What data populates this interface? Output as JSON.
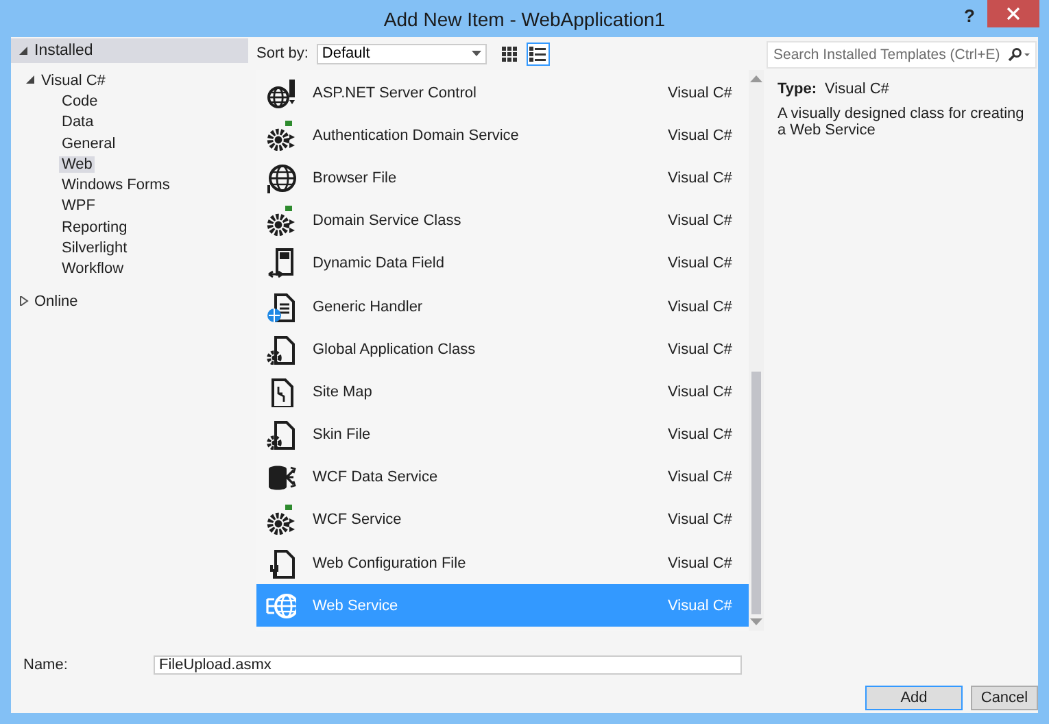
{
  "window": {
    "title": "Add New Item - WebApplication1",
    "help_button": "?"
  },
  "tree": [
    {
      "label": "Installed",
      "expanded": true,
      "selected": false,
      "children": [
        {
          "label": "Visual C#",
          "expanded": true,
          "selected": false,
          "children": [
            {
              "label": "Code",
              "selected": false
            },
            {
              "label": "Data",
              "selected": false
            },
            {
              "label": "General",
              "selected": false
            },
            {
              "label": "Web",
              "selected": true
            },
            {
              "label": "Windows Forms",
              "selected": false
            },
            {
              "label": "WPF",
              "selected": false
            },
            {
              "label": "Reporting",
              "selected": false
            },
            {
              "label": "Silverlight",
              "selected": false
            },
            {
              "label": "Workflow",
              "selected": false
            }
          ]
        }
      ]
    },
    {
      "label": "Online",
      "expanded": false,
      "selected": false
    }
  ],
  "sort": {
    "label": "Sort by:",
    "value": "Default"
  },
  "views": [
    {
      "kind": "grid",
      "selected": false
    },
    {
      "kind": "list",
      "selected": true
    }
  ],
  "search": {
    "placeholder": "Search Installed Templates (Ctrl+E)"
  },
  "templates": [
    {
      "name": "ASP.NET Server Control",
      "language": "Visual C#",
      "kind": "control",
      "selected": false
    },
    {
      "name": "Authentication Domain Service",
      "language": "Visual C#",
      "kind": "service",
      "selected": false
    },
    {
      "name": "Browser File",
      "language": "Visual C#",
      "kind": "globe",
      "selected": false
    },
    {
      "name": "Domain Service Class",
      "language": "Visual C#",
      "kind": "service",
      "selected": false
    },
    {
      "name": "Dynamic Data Field",
      "language": "Visual C#",
      "kind": "field",
      "selected": false
    },
    {
      "name": "Generic Handler",
      "language": "Visual C#",
      "kind": "handler",
      "selected": false
    },
    {
      "name": "Global Application Class",
      "language": "Visual C#",
      "kind": "gearfile",
      "selected": false
    },
    {
      "name": "Site Map",
      "language": "Visual C#",
      "kind": "sitemap",
      "selected": false
    },
    {
      "name": "Skin File",
      "language": "Visual C#",
      "kind": "gearfile",
      "selected": false
    },
    {
      "name": "WCF Data Service",
      "language": "Visual C#",
      "kind": "database",
      "selected": false
    },
    {
      "name": "WCF Service",
      "language": "Visual C#",
      "kind": "service",
      "selected": false
    },
    {
      "name": "Web Configuration File",
      "language": "Visual C#",
      "kind": "wrenchfile",
      "selected": false
    },
    {
      "name": "Web Service",
      "language": "Visual C#",
      "kind": "webservice",
      "selected": true
    }
  ],
  "details": {
    "type_label": "Type:",
    "type_value": "Visual C#",
    "description": "A visually designed class for creating a Web Service"
  },
  "name_field": {
    "label": "Name:",
    "value": "FileUpload.asmx"
  },
  "buttons": [
    {
      "label": "Add",
      "default": true
    },
    {
      "label": "Cancel",
      "default": false
    }
  ]
}
